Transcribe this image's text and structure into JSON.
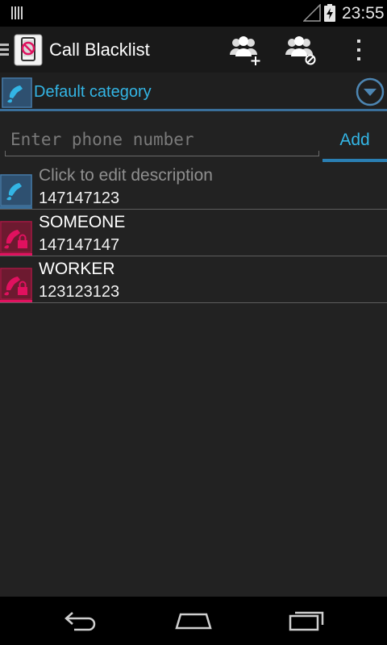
{
  "status_bar": {
    "time": "23:55",
    "icons": [
      "notification-icon",
      "signal-icon",
      "battery-charging-icon"
    ]
  },
  "action_bar": {
    "title": "Call Blacklist",
    "actions": [
      "add-contact-group-icon",
      "block-contact-group-icon",
      "overflow-menu-icon"
    ]
  },
  "category": {
    "label": "Default category"
  },
  "input": {
    "placeholder": "Enter phone number",
    "value": "",
    "add_label": "Add"
  },
  "list": {
    "items": [
      {
        "description": "Click to edit description",
        "number": "147147123",
        "type": "allowed",
        "placeholder": true
      },
      {
        "description": "SOMEONE",
        "number": "147147147",
        "type": "blocked",
        "placeholder": false
      },
      {
        "description": "WORKER",
        "number": "123123123",
        "type": "blocked",
        "placeholder": false
      }
    ]
  },
  "colors": {
    "accent": "#33b5e5",
    "blocked": "#e0115f",
    "allowed_icon_bg": "#2e5070",
    "blocked_icon_bg": "#6d1a30",
    "background": "#222222"
  },
  "nav_bar": {
    "buttons": [
      "back-icon",
      "home-icon",
      "recents-icon"
    ]
  }
}
